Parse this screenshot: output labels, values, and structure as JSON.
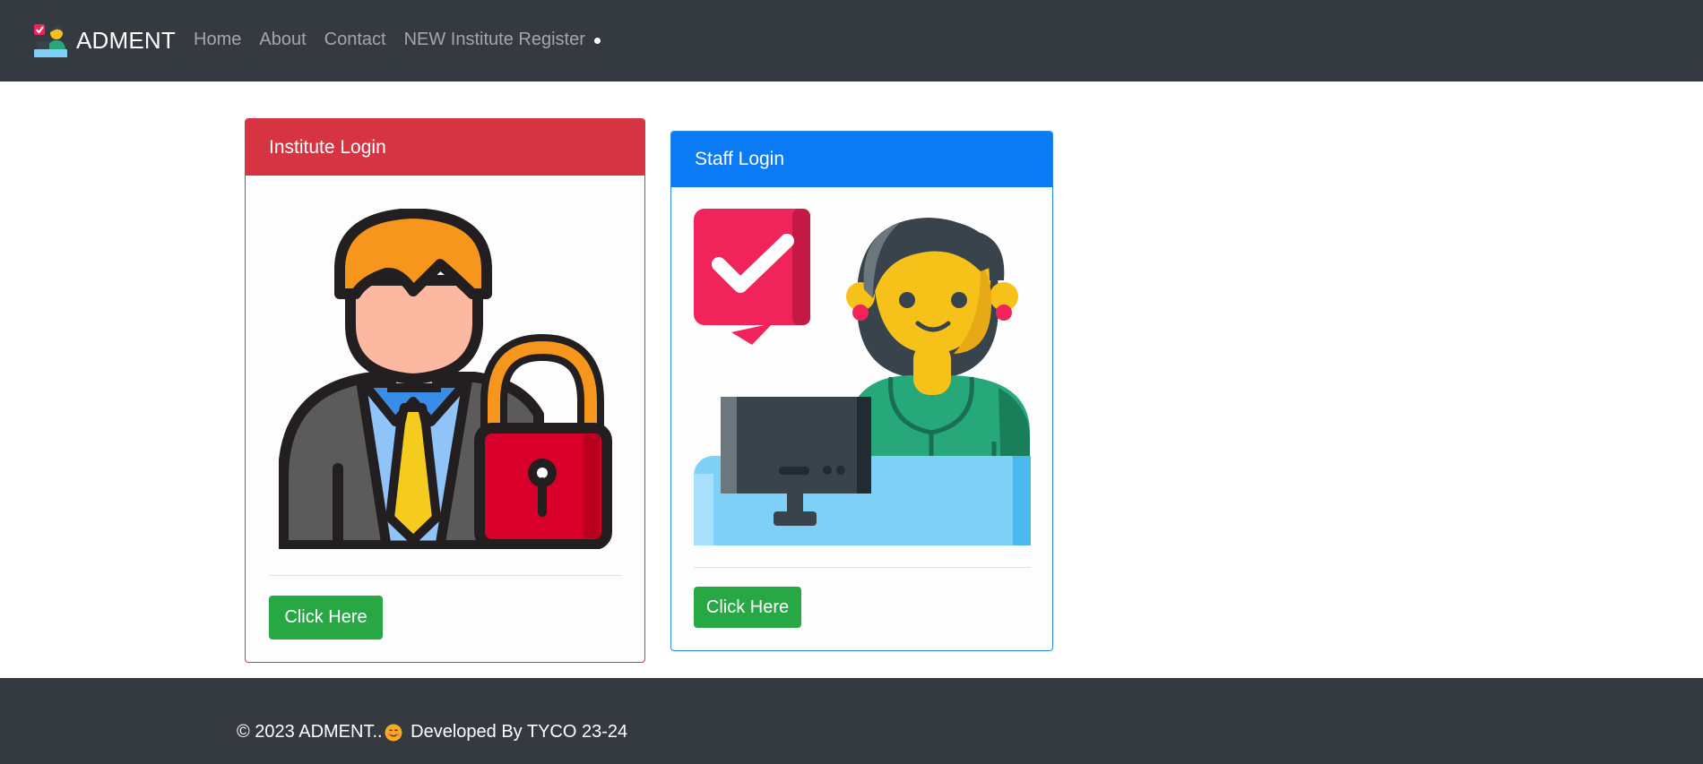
{
  "navbar": {
    "brand_logo": "office-worker-icon",
    "brand": "ADMENT",
    "links": [
      {
        "label": "Home"
      },
      {
        "label": "About"
      },
      {
        "label": "Contact"
      },
      {
        "label": "NEW Institute Register"
      }
    ]
  },
  "cards": {
    "institute": {
      "title": "Institute Login",
      "image": "businessman-with-padlock-icon",
      "button": "Click Here",
      "color": "#d63343"
    },
    "staff": {
      "title": "Staff Login",
      "image": "staff-woman-at-computer-icon",
      "button": "Click Here",
      "color": "#0a7bf5"
    }
  },
  "footer": {
    "prefix": "© 2023 ADMENT..",
    "suffix": " Developed By TYCO 23-24",
    "emoji": "smiley-icon"
  },
  "colors": {
    "navbar": "#343a40",
    "button": "#28a745"
  }
}
